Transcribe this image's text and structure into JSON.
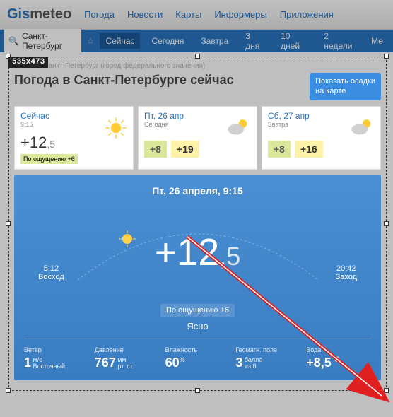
{
  "logo": {
    "part1": "Gis",
    "part2": "meteo"
  },
  "nav": [
    "Погода",
    "Новости",
    "Карты",
    "Информеры",
    "Приложения"
  ],
  "search": {
    "city": "Санкт-Петербург"
  },
  "tabs": [
    "Сейчас",
    "Сегодня",
    "Завтра",
    "3 дня",
    "10 дней",
    "2 недели",
    "Ме"
  ],
  "breadcrumb": "Россия / Санкт-Петербург (город федерального значения)",
  "title": "Погода в Санкт-Петербурге сейчас",
  "precip_btn": {
    "line1": "Показать осадки",
    "line2": "на карте"
  },
  "cards": [
    {
      "title": "Сейчас",
      "sub": "9:15",
      "temp_int": "+12",
      "temp_frac": ",5",
      "feels": "По ощущению +6",
      "icon": "sun"
    },
    {
      "title": "Пт, 26 апр",
      "sub": "Сегодня",
      "low": "+8",
      "high": "+19",
      "icon": "cloud-sun"
    },
    {
      "title": "Сб, 27 апр",
      "sub": "Завтра",
      "low": "+8",
      "high": "+16",
      "icon": "cloud-sun"
    }
  ],
  "hero": {
    "datetime": "Пт, 26 апреля, 9:15",
    "sunrise": {
      "time": "5:12",
      "label": "Восход"
    },
    "sunset": {
      "time": "20:42",
      "label": "Заход"
    },
    "temp_int": "+12",
    "temp_frac": ",5",
    "feels": "По ощущению +6",
    "condition": "Ясно",
    "stats": {
      "wind": {
        "label": "Ветер",
        "val": "1",
        "unit1": "м/с",
        "unit2": "Восточный"
      },
      "pressure": {
        "label": "Давление",
        "val": "767",
        "unit1": "мм",
        "unit2": "рт. ст."
      },
      "humidity": {
        "label": "Влажность",
        "val": "60",
        "unit": "%"
      },
      "geo": {
        "label": "Геомагн. поле",
        "val": "3",
        "unit1": "балла",
        "unit2": "из 8"
      },
      "water": {
        "label": "Вода",
        "val": "+8,5",
        "unit": "°C"
      }
    }
  },
  "size_label": "535x473"
}
